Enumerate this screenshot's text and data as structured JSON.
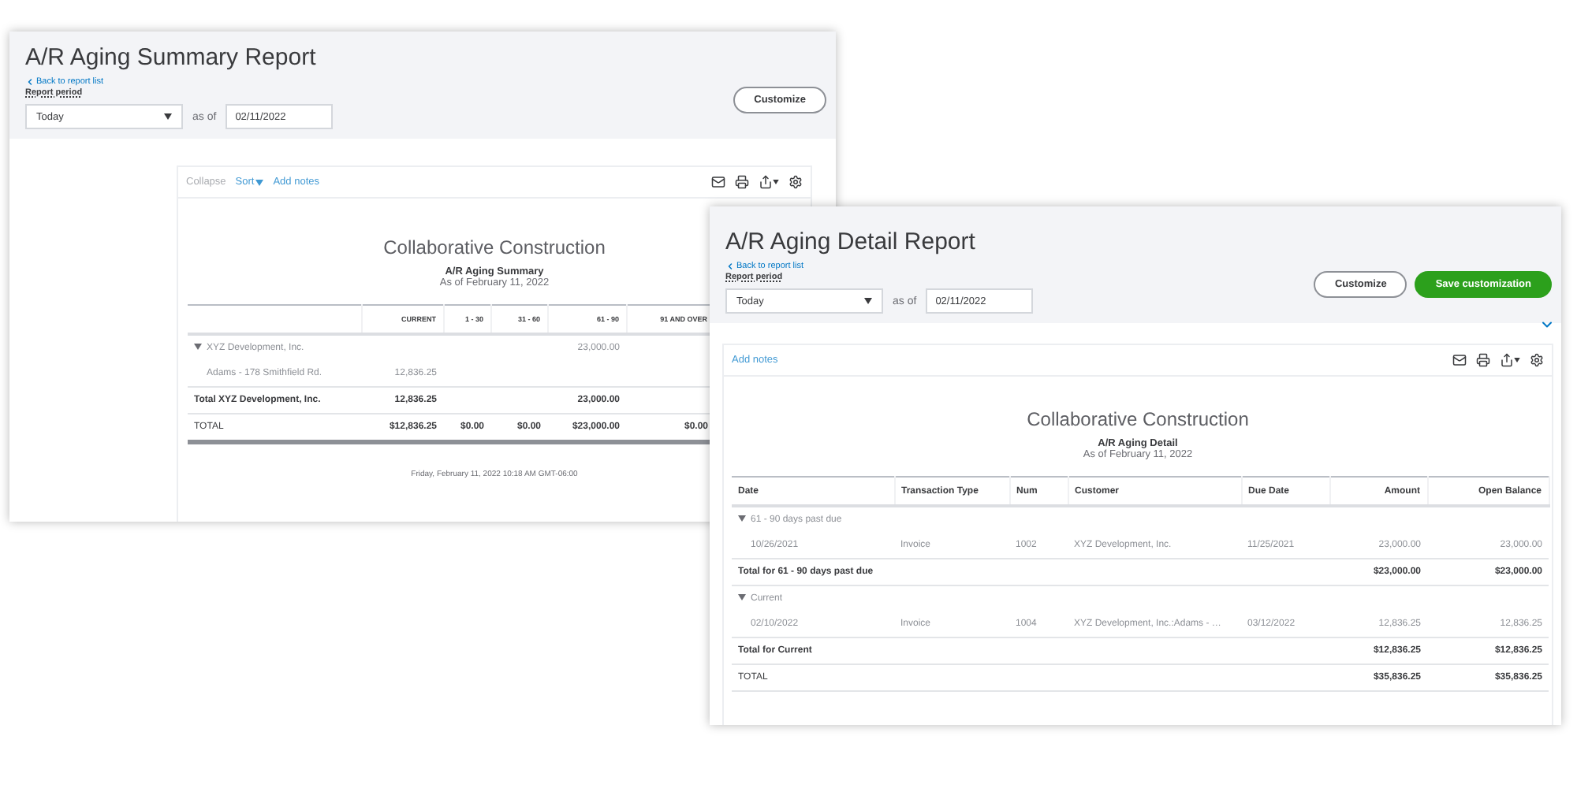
{
  "windows": [
    {
      "kind": "summary",
      "title": "A/R Aging Summary Report",
      "back_link": "Back to report list",
      "period_label": "Report period",
      "period": "Today",
      "as_of_label": "as of",
      "date": "02/11/2022",
      "buttons": [
        {
          "label": "Customize",
          "kind": "secondary"
        }
      ],
      "toolbar": [
        {
          "label": "Collapse",
          "kind": "link"
        },
        {
          "label": "Sort",
          "kind": "menu"
        },
        {
          "label": "Add notes",
          "kind": "link"
        }
      ],
      "report": {
        "company": "Collaborative Construction",
        "name": "A/R Aging Summary",
        "as_of": "As of February 11, 2022",
        "columns": [
          "",
          "CURRENT",
          "1 - 30",
          "31 - 60",
          "61 - 90",
          "91 AND OVER"
        ],
        "rows": [
          {
            "kind": "group",
            "expanded": true,
            "cells": [
              "XYZ Development, Inc.",
              null,
              null,
              null,
              "23,000.00",
              null
            ]
          },
          {
            "kind": "data",
            "cells": [
              "Adams - 178 Smithfield Rd.",
              "12,836.25",
              null,
              null,
              null,
              null
            ]
          },
          {
            "kind": "total",
            "cells": [
              "Total XYZ Development, Inc.",
              "12,836.25",
              null,
              null,
              "23,000.00",
              null
            ]
          },
          {
            "kind": "grand",
            "cells": [
              "TOTAL",
              "$12,836.25",
              "$0.00",
              "$0.00",
              "$23,000.00",
              "$0.00"
            ]
          }
        ],
        "footer": "Friday, February 11, 2022  10:18 AM GMT-06:00"
      }
    },
    {
      "kind": "detail",
      "title": "A/R Aging Detail Report",
      "back_link": "Back to report list",
      "period_label": "Report period",
      "period": "Today",
      "as_of_label": "as of",
      "date": "02/11/2022",
      "buttons": [
        {
          "label": "Customize",
          "kind": "secondary"
        },
        {
          "label": "Save customization",
          "kind": "primary"
        }
      ],
      "toolbar": [
        {
          "label": "Add notes",
          "kind": "link"
        }
      ],
      "report": {
        "company": "Collaborative Construction",
        "name": "A/R Aging Detail",
        "as_of": "As of February 11, 2022",
        "columns": [
          "Date",
          "Transaction Type",
          "Num",
          "Customer",
          "Due Date",
          "Amount",
          "Open Balance"
        ],
        "rows": [
          {
            "kind": "group",
            "expanded": true,
            "cells": [
              "61 - 90 days past due",
              null,
              null,
              null,
              null,
              null,
              null
            ]
          },
          {
            "kind": "data",
            "cells": [
              "10/26/2021",
              "Invoice",
              "1002",
              "XYZ Development, Inc.",
              "11/25/2021",
              "23,000.00",
              "23,000.00"
            ]
          },
          {
            "kind": "total",
            "cells": [
              "Total for 61 - 90 days past due",
              null,
              null,
              null,
              null,
              "$23,000.00",
              "$23,000.00"
            ]
          },
          {
            "kind": "group",
            "expanded": true,
            "cells": [
              "Current",
              null,
              null,
              null,
              null,
              null,
              null
            ]
          },
          {
            "kind": "data",
            "cells": [
              "02/10/2022",
              "Invoice",
              "1004",
              "XYZ Development, Inc.:Adams - …",
              "03/12/2022",
              "12,836.25",
              "12,836.25"
            ]
          },
          {
            "kind": "total",
            "cells": [
              "Total for Current",
              null,
              null,
              null,
              null,
              "$12,836.25",
              "$12,836.25"
            ]
          },
          {
            "kind": "grand",
            "cells": [
              "TOTAL",
              null,
              null,
              null,
              null,
              "$35,836.25",
              "$35,836.25"
            ]
          }
        ]
      }
    }
  ]
}
